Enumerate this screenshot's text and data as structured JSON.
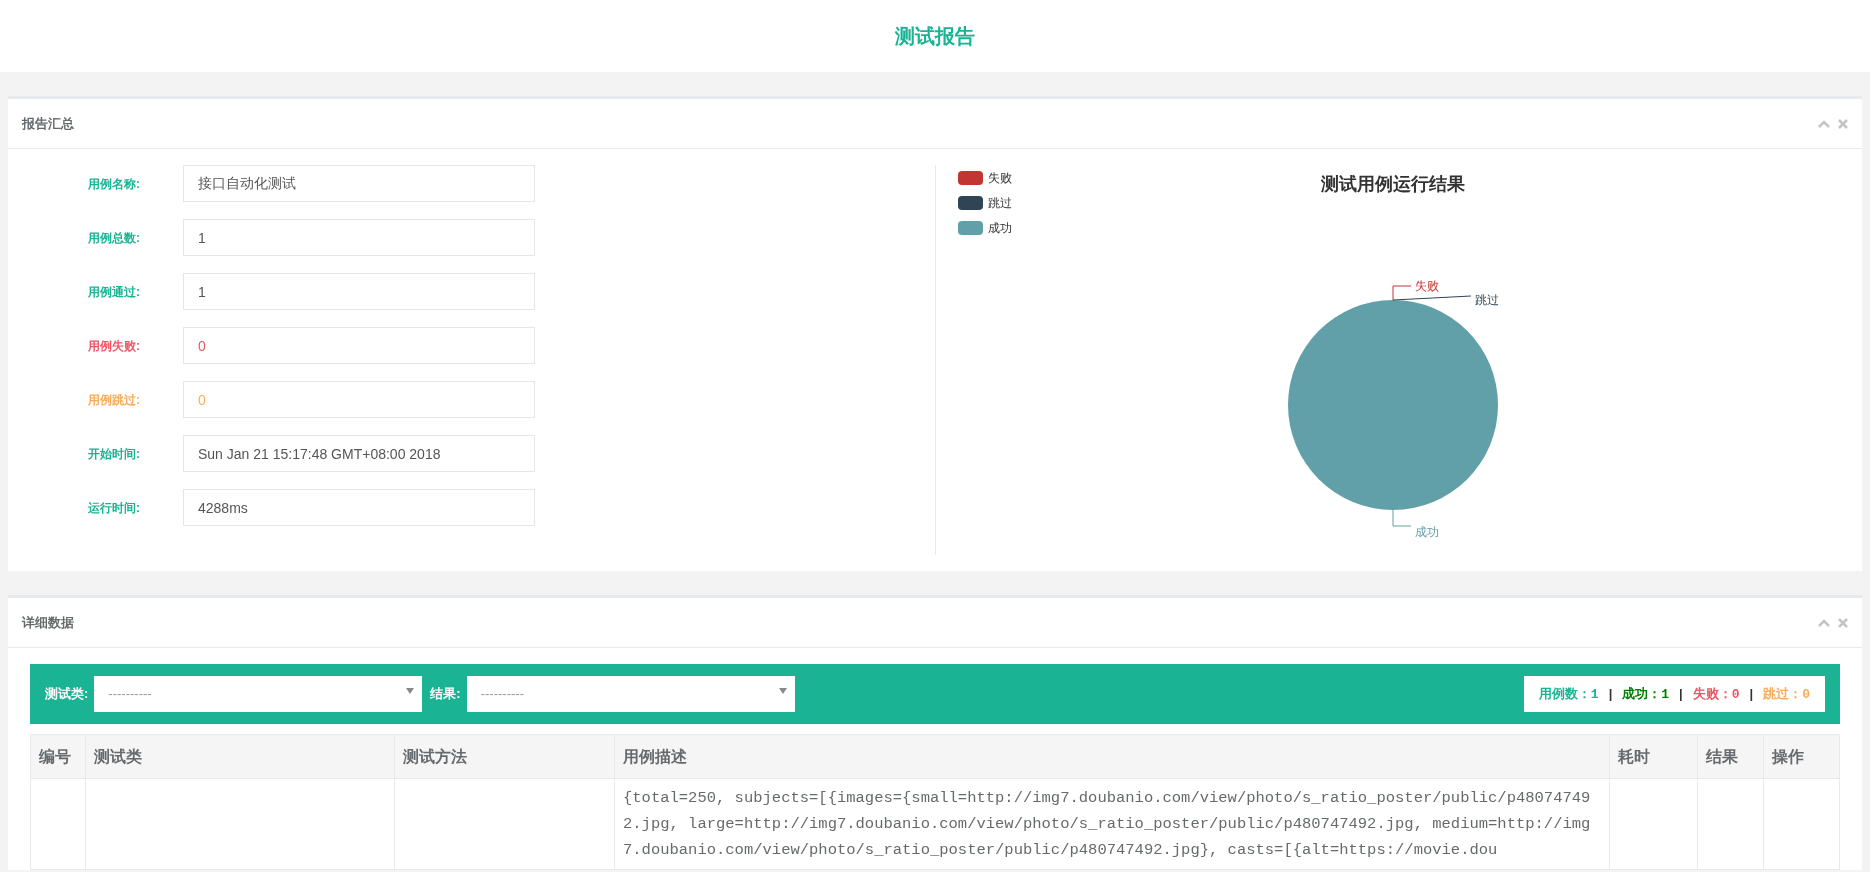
{
  "page_title": "测试报告",
  "summary_panel": {
    "title": "报告汇总",
    "fields": [
      {
        "label": "用例名称:",
        "value": "接口自动化测试",
        "color": "#1ab394"
      },
      {
        "label": "用例总数:",
        "value": "1",
        "color": "#1ab394"
      },
      {
        "label": "用例通过:",
        "value": "1",
        "color": "#1ab394"
      },
      {
        "label": "用例失败:",
        "value": "0",
        "color": "#ed5565"
      },
      {
        "label": "用例跳过:",
        "value": "0",
        "color": "#f8ac59"
      },
      {
        "label": "开始时间:",
        "value": "Sun Jan 21 15:17:48 GMT+08:00 2018",
        "color": "#1ab394"
      },
      {
        "label": "运行时间:",
        "value": "4288ms",
        "color": "#1ab394"
      }
    ],
    "legend": [
      {
        "label": "失败",
        "color": "#c23531"
      },
      {
        "label": "跳过",
        "color": "#2f4554"
      },
      {
        "label": "成功",
        "color": "#61a0a8"
      }
    ],
    "chart_data": {
      "type": "pie",
      "title": "测试用例运行结果",
      "categories": [
        "失败",
        "跳过",
        "成功"
      ],
      "values": [
        0,
        0,
        1
      ]
    }
  },
  "detail_panel": {
    "title": "详细数据",
    "filters": [
      {
        "label": "测试类:",
        "placeholder": "----------"
      },
      {
        "label": "结果:",
        "placeholder": "----------"
      }
    ],
    "stats": {
      "separator": "|",
      "items": [
        {
          "label": "用例数：",
          "value": "1",
          "color": "#1ab394"
        },
        {
          "label": "成功：",
          "value": "1",
          "color": "#008000"
        },
        {
          "label": "失败：",
          "value": "0",
          "color": "#ed5565"
        },
        {
          "label": "跳过：",
          "value": "0",
          "color": "#f8ac59"
        }
      ]
    },
    "table": {
      "columns": [
        "编号",
        "测试类",
        "测试方法",
        "用例描述",
        "耗时",
        "结果",
        "操作"
      ],
      "rows": [
        {
          "description": "{total=250, subjects=[{images={small=http://img7.doubanio.com/view/photo/s_ratio_poster/public/p480747492.jpg, large=http://img7.doubanio.com/view/photo/s_ratio_poster/public/p480747492.jpg, medium=http://img7.doubanio.com/view/photo/s_ratio_poster/public/p480747492.jpg}, casts=[{alt=https://movie.dou"
        }
      ]
    }
  }
}
